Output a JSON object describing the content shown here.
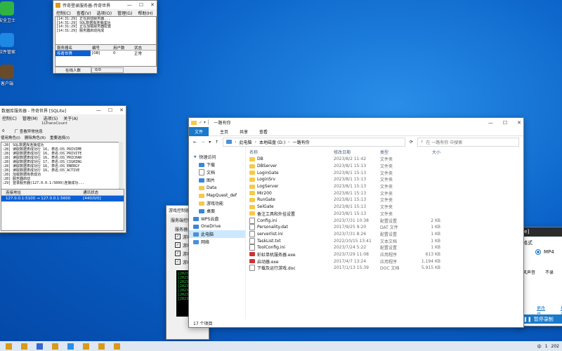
{
  "desktop": {
    "icons": [
      {
        "label": "安全卫士",
        "color": "#2fb443"
      },
      {
        "label": "软件管家",
        "color": "#1e88e5"
      },
      {
        "label": "客户端",
        "color": "#6b4a2a"
      }
    ]
  },
  "loginwin": {
    "title": "传奇登录服务器-传奇世界",
    "menu": [
      "控制(C)",
      "查看(V)",
      "选项(O)",
      "管理(G)",
      "帮助(H)"
    ],
    "log": [
      "[14:31:29] 正在启动服务器...",
      "[14:31:29] SQL数据库连接成功",
      "[14:31:29] 正在加载服务器配置",
      "[14:31:29] 服务器启动完成"
    ],
    "columns": [
      "服务器名",
      "编号",
      "用户数",
      "状态"
    ],
    "rows": [
      [
        "传奇世界",
        "[0B]",
        "0",
        "正常"
      ]
    ],
    "status_label": "在线人数",
    "status_value": "0/0"
  },
  "dbwin": {
    "title": "数据库服务器 - 传奇世界 [SQLite]",
    "menu": [
      "控制(C)",
      "管理(M)",
      "选项(S)",
      "关于(A)"
    ],
    "toolbar_text": "1LTransCount",
    "opt_zero": "0",
    "opt_label": "厂 查看异常信息",
    "opt2": "使用角色(I)",
    "opt3": "删除角色(R)",
    "opt4": "重要选择(I)",
    "log": [
      ":28] SQL数据库连接成功",
      ":28] 读取数据表成功行 16, 表名:DS_PRIVIME",
      ":28] 读取数据表成功行 16, 表名:DS_PRIVITE",
      ":28] 读取数据表成功行 16, 表名:DS_PRICHAR",
      ":28] 读取数据表成功行 17, 表名:DS_CIGHING",
      ":28] 读取数据表成功行 16, 表名:DS_ENERGY",
      ":28] 读取数据表成功行 16, 表名:DS_ACTIVE",
      ":28] 加载数据库表成功",
      ":28] 服务器启动",
      ":29] 登录服务器(127.0.0.1:5600)连接成功..."
    ],
    "columns": [
      "连接地址",
      "通讯状态"
    ],
    "rows": [
      [
        "127.0.0.1:5100 → 127.0.0.1:5600",
        "[440/0/0]"
      ]
    ]
  },
  "gatewin": {
    "title": "游戏控制器",
    "tab": "服务端控制",
    "group": "服务器控",
    "checks": [
      "游戏",
      "游戏",
      "游戏",
      "游戏"
    ],
    "log": [
      "[2023/",
      "[2023/",
      "[2023/",
      "[2023/",
      "[2023/",
      "[2023/",
      "[2023/"
    ]
  },
  "explorer": {
    "title": "一路有你",
    "ribbon": [
      "文件",
      "主页",
      "共享",
      "查看"
    ],
    "path": [
      "此电脑",
      "本地磁盘 (D:)",
      "一路有你"
    ],
    "search_placeholder": "在 一路有你 中搜索",
    "nav": [
      {
        "label": "快速访问",
        "icon": "star",
        "sub": false,
        "sel": false
      },
      {
        "label": "下载",
        "icon": "blue",
        "sub": true,
        "sel": false
      },
      {
        "label": "文档",
        "icon": "doc",
        "sub": true,
        "sel": false
      },
      {
        "label": "图片",
        "icon": "blue",
        "sub": true,
        "sel": false
      },
      {
        "label": "Data",
        "icon": "folder",
        "sub": true,
        "sel": false
      },
      {
        "label": "MapQuest_def",
        "icon": "folder",
        "sub": true,
        "sel": false
      },
      {
        "label": "游戏功能",
        "icon": "folder",
        "sub": true,
        "sel": false
      },
      {
        "label": "桌面",
        "icon": "blue",
        "sub": true,
        "sel": false
      },
      {
        "label": "WPS云盘",
        "icon": "blue",
        "sub": false,
        "sel": false
      },
      {
        "label": "OneDrive",
        "icon": "blue",
        "sub": false,
        "sel": false
      },
      {
        "label": "此电脑",
        "icon": "pc",
        "sub": false,
        "sel": true
      },
      {
        "label": "网络",
        "icon": "pc",
        "sub": false,
        "sel": false
      }
    ],
    "columns": [
      "名称",
      "修改日期",
      "类型",
      "大小"
    ],
    "files": [
      {
        "name": "DB",
        "date": "2023/8/2 11:42",
        "type": "文件夹",
        "size": "",
        "icon": "folder"
      },
      {
        "name": "DBServer",
        "date": "2023/8/1 15:13",
        "type": "文件夹",
        "size": "",
        "icon": "folder"
      },
      {
        "name": "LoginGate",
        "date": "2023/8/1 15:13",
        "type": "文件夹",
        "size": "",
        "icon": "folder"
      },
      {
        "name": "LoginSrv",
        "date": "2023/8/1 15:13",
        "type": "文件夹",
        "size": "",
        "icon": "folder"
      },
      {
        "name": "LogServer",
        "date": "2023/8/1 15:13",
        "type": "文件夹",
        "size": "",
        "icon": "folder"
      },
      {
        "name": "Mir200",
        "date": "2023/8/1 15:13",
        "type": "文件夹",
        "size": "",
        "icon": "folder"
      },
      {
        "name": "RunGate",
        "date": "2023/8/1 15:13",
        "type": "文件夹",
        "size": "",
        "icon": "folder"
      },
      {
        "name": "SelGate",
        "date": "2023/8/1 15:13",
        "type": "文件夹",
        "size": "",
        "icon": "folder"
      },
      {
        "name": "备注工具和外挂设置",
        "date": "2023/8/1 15:13",
        "type": "文件夹",
        "size": "",
        "icon": "folder"
      },
      {
        "name": "Config.ini",
        "date": "2023/7/31 10:38",
        "type": "配置设置",
        "size": "2 KB",
        "icon": "doc"
      },
      {
        "name": "Personality.dat",
        "date": "2017/9/25 9:20",
        "type": "DAT 文件",
        "size": "1 KB",
        "icon": "doc"
      },
      {
        "name": "serverlist.ini",
        "date": "2023/7/31 8:26",
        "type": "配置设置",
        "size": "1 KB",
        "icon": "doc"
      },
      {
        "name": "TaskList.txt",
        "date": "2022/10/15 13:41",
        "type": "文本文档",
        "size": "1 KB",
        "icon": "doc"
      },
      {
        "name": "ToolConfig.ini",
        "date": "2023/7/24 5:22",
        "type": "配置设置",
        "size": "1 KB",
        "icon": "doc"
      },
      {
        "name": "彩虹单机服务器.exe",
        "date": "2023/7/29 11:08",
        "type": "应用程序",
        "size": "613 KB",
        "icon": "exe"
      },
      {
        "name": "启动器.exe",
        "date": "2017/4/7 13:24",
        "type": "应用程序",
        "size": "1,194 KB",
        "icon": "exe"
      },
      {
        "name": "下载及运行游戏.doc",
        "date": "2017/1/13 15:39",
        "type": "DOC 文档",
        "size": "5,915 KB",
        "icon": "doc"
      }
    ],
    "status": "17 个项目"
  },
  "recorder": {
    "title": ".Me]",
    "format_label": "格式",
    "format_value": "MP4",
    "audio_label": "风声音",
    "audio_opt": "不录",
    "link1": "更改目",
    "link2": "打开",
    "button": "暂停录制"
  },
  "taskbar": {
    "apps": [
      "#d89b1c",
      "#d89b1c",
      "#3467d1",
      "#d89b1c",
      "#2a8fe8",
      "#d89b1c",
      "#d89b1c",
      "#d89b1c"
    ],
    "tray_ime": "中",
    "time": "1",
    "date": "202"
  }
}
